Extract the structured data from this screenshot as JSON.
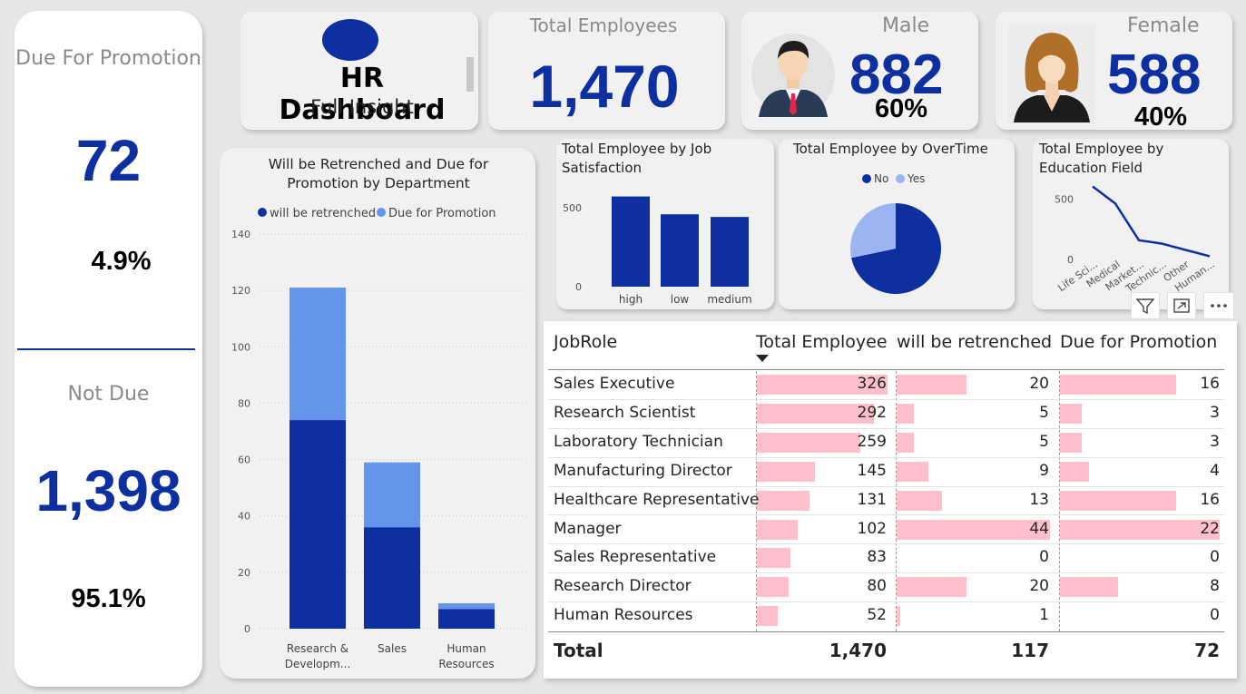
{
  "promotion_panel": {
    "due_title": "Due For Promotion",
    "due_value": "72",
    "due_pct": "4.9%",
    "not_due_title": "Not Due",
    "not_due_value": "1,398",
    "not_due_pct": "95.1%"
  },
  "header": {
    "title": "HR Dashboard",
    "subtitle": "Full Insight"
  },
  "kpis": {
    "total_title": "Total Employees",
    "total_value": "1,470",
    "male_title": "Male",
    "male_value": "882",
    "male_pct": "60%",
    "female_title": "Female",
    "female_value": "588",
    "female_pct": "40%"
  },
  "colors": {
    "dark_blue": "#0d2f9f",
    "light_blue": "#6594ed",
    "pink_bar": "#ffc0cb",
    "card_bg": "#f1f1f1"
  },
  "visual_header_icons": [
    "filter-icon",
    "focus-mode-icon",
    "more-options-icon"
  ],
  "chart_data": [
    {
      "id": "dept",
      "type": "bar",
      "stacked": true,
      "title": "Will be Retrenched and Due for Promotion by Department",
      "legend": [
        "will be retrenched",
        "Due for Promotion"
      ],
      "legend_position": "top",
      "categories": [
        "Research & Developm...",
        "Sales",
        "Human Resources"
      ],
      "series": [
        {
          "name": "will be retrenched",
          "values": [
            74,
            36,
            7
          ],
          "color": "#0d2f9f"
        },
        {
          "name": "Due for Promotion",
          "values": [
            47,
            23,
            2
          ],
          "color": "#6594ed"
        }
      ],
      "ylim": [
        0,
        140
      ],
      "yticks": [
        "0",
        "20",
        "40",
        "60",
        "80",
        "100",
        "120",
        "140"
      ],
      "grid": true
    },
    {
      "id": "jobsat",
      "type": "bar",
      "title": "Total Employee by Job Satisfaction",
      "categories": [
        "high",
        "low",
        "medium"
      ],
      "values": [
        572,
        459,
        442
      ],
      "ylim": [
        0,
        650
      ],
      "yticks": [
        "0",
        "500"
      ],
      "color": "#0d2f9f"
    },
    {
      "id": "overtime",
      "type": "pie",
      "title": "Total Employee by OverTime",
      "legend": [
        "No",
        "Yes"
      ],
      "legend_position": "top",
      "slices": [
        {
          "label": "No",
          "value": 1054,
          "color": "#0d2f9f"
        },
        {
          "label": "Yes",
          "value": 416,
          "color": "#9ab5f2"
        }
      ]
    },
    {
      "id": "education",
      "type": "line",
      "title": "Total Employee by Education Field",
      "categories": [
        "Life Sci...",
        "Medical",
        "Market...",
        "Technic...",
        "Other",
        "Human..."
      ],
      "values": [
        606,
        464,
        159,
        132,
        82,
        27
      ],
      "ylim": [
        0,
        700
      ],
      "yticks": [
        "0",
        "500"
      ],
      "color": "#0d2f9f"
    },
    {
      "id": "jobrole_table",
      "type": "table",
      "columns": [
        "JobRole",
        "Total Employee",
        "will be retrenched",
        "Due for Promotion"
      ],
      "rows": [
        {
          "role": "Sales Executive",
          "total": "326",
          "retrenched": "20",
          "promo": "16"
        },
        {
          "role": "Research Scientist",
          "total": "292",
          "retrenched": "5",
          "promo": "3"
        },
        {
          "role": "Laboratory Technician",
          "total": "259",
          "retrenched": "5",
          "promo": "3"
        },
        {
          "role": "Manufacturing Director",
          "total": "145",
          "retrenched": "9",
          "promo": "4"
        },
        {
          "role": "Healthcare Representative",
          "total": "131",
          "retrenched": "13",
          "promo": "16"
        },
        {
          "role": "Manager",
          "total": "102",
          "retrenched": "44",
          "promo": "22"
        },
        {
          "role": "Sales Representative",
          "total": "83",
          "retrenched": "0",
          "promo": "0"
        },
        {
          "role": "Research Director",
          "total": "80",
          "retrenched": "20",
          "promo": "8"
        },
        {
          "role": "Human Resources",
          "total": "52",
          "retrenched": "1",
          "promo": "0"
        }
      ],
      "totals": {
        "label": "Total",
        "total": "1,470",
        "retrenched": "117",
        "promo": "72"
      }
    }
  ]
}
